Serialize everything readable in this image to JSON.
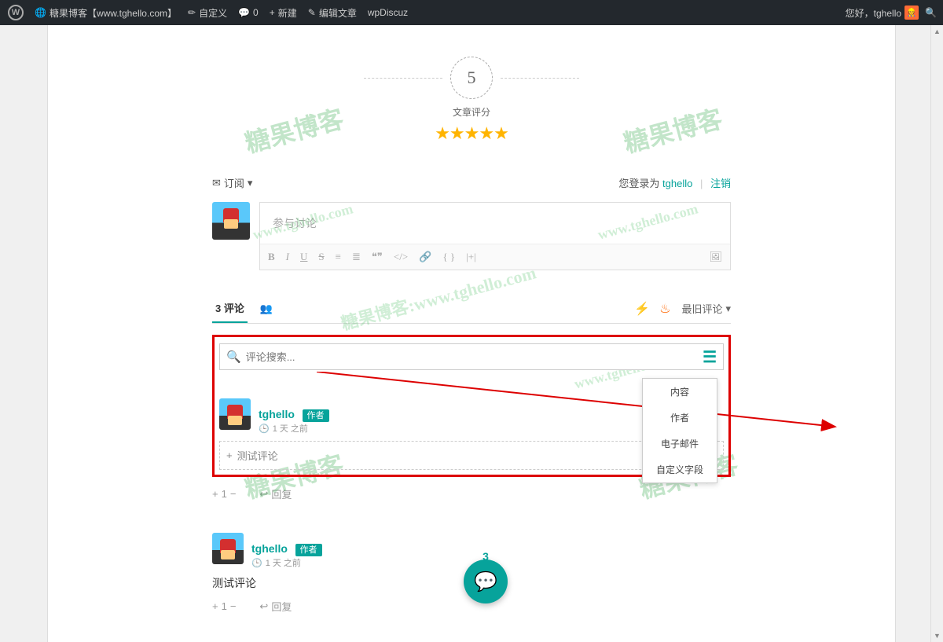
{
  "adminbar": {
    "site_name": "糖果博客【www.tghello.com】",
    "customize": "自定义",
    "comments_count": "0",
    "new": "新建",
    "edit": "编辑文章",
    "wpdiscuz": "wpDiscuz",
    "greeting": "您好，tghello"
  },
  "rating": {
    "score": "5",
    "label": "文章评分",
    "stars": "★★★★★"
  },
  "subrow": {
    "subscribe": "订阅",
    "logged_as": "您登录为",
    "username": "tghello",
    "logout": "注销"
  },
  "editor": {
    "placeholder": "参与讨论",
    "image_icon": "🖼"
  },
  "toolbar": {
    "bold": "B",
    "italic": "I",
    "underline": "U",
    "strike": "S",
    "ol": "≡",
    "ul": "≣",
    "quote": "❝❞",
    "code": "</>",
    "link": "🔗",
    "braces": "{ }",
    "plus": "|+|"
  },
  "tabs": {
    "comments_count": "3",
    "comments_label": "评论",
    "users_icon": "👥",
    "sort": "最旧评论"
  },
  "search": {
    "placeholder": "评论搜索...",
    "menu": [
      "内容",
      "作者",
      "电子邮件",
      "自定义字段"
    ]
  },
  "comment1": {
    "author": "tghello",
    "badge": "作者",
    "time": "1 天 之前",
    "test_label": "测试评论",
    "vote": "1",
    "reply": "回复"
  },
  "float": {
    "badge": "3"
  },
  "comment2": {
    "author": "tghello",
    "badge": "作者",
    "time": "1 天 之前",
    "body": "测试评论",
    "vote": "1",
    "reply": "回复"
  },
  "watermarks": {
    "big": "糖果博客",
    "url1": "www.tghello.com",
    "url2": "糖果博客:www.tghello.com",
    "url3": "www.tghello.com"
  }
}
